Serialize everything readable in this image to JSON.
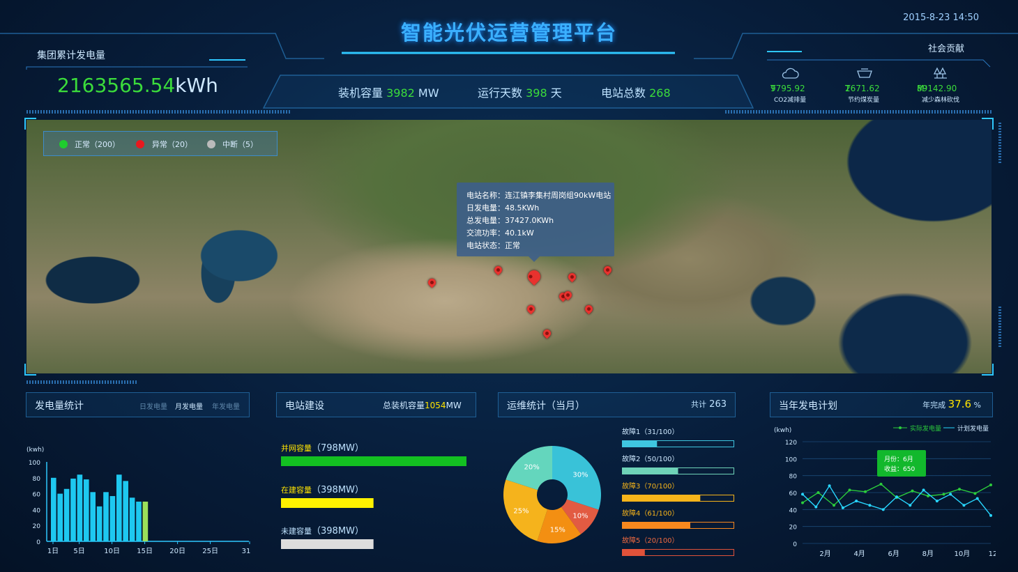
{
  "header": {
    "title": "智能光伏运营管理平台",
    "datetime": "2015-8-23 14:50"
  },
  "cumulative": {
    "label": "集团累计发电量",
    "value": "2163565.54",
    "unit": "kWh"
  },
  "stats": [
    {
      "label": "装机容量",
      "value": "3982",
      "unit": "MW"
    },
    {
      "label": "运行天数",
      "value": "398",
      "unit": "天"
    },
    {
      "label": "电站总数",
      "value": "268",
      "unit": ""
    }
  ],
  "contribution": {
    "label": "社会贡献",
    "items": [
      {
        "icon": "cloud-icon",
        "value": "9795.92",
        "unit": "T",
        "desc": "CO2减排量"
      },
      {
        "icon": "coal-icon",
        "value": "2671.62",
        "unit": "T",
        "desc": "节约煤炭量"
      },
      {
        "icon": "forest-icon",
        "value": "89142.90",
        "unit": "M³",
        "desc": "减少森林砍伐"
      }
    ]
  },
  "legend": [
    {
      "label": "正常（200）",
      "color": "#1fcc2e"
    },
    {
      "label": "异常（20）",
      "color": "#e8191e"
    },
    {
      "label": "中断（5）",
      "color": "#bbbbbb"
    }
  ],
  "tooltip": {
    "lines": [
      "电站名称：连江镇李集村周岗组90kW电站",
      "日发电量：48.5KWh",
      "总发电量：37427.0KWh",
      "交流功率：40.1kW",
      "电站状态：正常"
    ]
  },
  "panel_power": {
    "title": "发电量统计",
    "tabs": [
      "日发电量",
      "月发电量",
      "年发电量"
    ],
    "unit": "(kwh)",
    "y_ticks": [
      "100",
      "80",
      "60",
      "40",
      "20",
      "0"
    ],
    "x_ticks": [
      "1日",
      "5日",
      "10日",
      "15日",
      "20日",
      "25日",
      "31日"
    ]
  },
  "panel_build": {
    "title": "电站建设",
    "total_label": "总装机容量",
    "total_value": "1054",
    "total_unit": "MW",
    "items": [
      {
        "label": "并网容量",
        "value": "798",
        "unit": "MW"
      },
      {
        "label": "在建容量",
        "value": "398",
        "unit": "MW"
      },
      {
        "label": "未建容量",
        "value": "398",
        "unit": "MW"
      }
    ]
  },
  "panel_ops": {
    "title": "运维统计（当月）",
    "total_label": "共计",
    "total_value": "263",
    "faults": [
      {
        "label": "故障1（31/100）"
      },
      {
        "label": "故障2（50/100）"
      },
      {
        "label": "故障3（70/100）"
      },
      {
        "label": "故障4（61/100）"
      },
      {
        "label": "故障5（20/100）"
      }
    ],
    "pie_labels": [
      "30%",
      "10%",
      "15%",
      "25%",
      "20%"
    ]
  },
  "panel_plan": {
    "title": "当年发电计划",
    "complete_label": "年完成",
    "complete_value": "37.6",
    "complete_unit": "%",
    "unit": "(kwh)",
    "legend_actual": "实际发电量",
    "legend_plan": "计划发电量",
    "y_ticks": [
      "120",
      "100",
      "80",
      "60",
      "40",
      "20",
      "0"
    ],
    "x_ticks": [
      "2月",
      "4月",
      "6月",
      "8月",
      "10月",
      "12月"
    ],
    "tooltip": [
      "月份：6月",
      "收益：650"
    ]
  },
  "chart_data": [
    {
      "type": "bar",
      "title": "发电量统计",
      "ylabel": "(kwh)",
      "ylim": [
        0,
        100
      ],
      "x": [
        1,
        2,
        3,
        4,
        5,
        6,
        7,
        8,
        9,
        10,
        11,
        12,
        13,
        14,
        15
      ],
      "values": [
        80,
        60,
        66,
        79,
        84,
        78,
        62,
        44,
        62,
        57,
        84,
        76,
        55,
        50,
        50
      ],
      "colors": [
        "#1ec8f0",
        "#1ec8f0",
        "#1ec8f0",
        "#1ec8f0",
        "#1ec8f0",
        "#1ec8f0",
        "#1ec8f0",
        "#1ec8f0",
        "#1ec8f0",
        "#1ec8f0",
        "#1ec8f0",
        "#1ec8f0",
        "#1ec8f0",
        "#1ec8f0",
        "#9be05a"
      ]
    },
    {
      "type": "bar",
      "title": "电站建设",
      "categories": [
        "并网容量",
        "在建容量",
        "未建容量"
      ],
      "values": [
        798,
        398,
        398
      ],
      "colors": [
        "#13c021",
        "#fff200",
        "#dddddd"
      ]
    },
    {
      "type": "bar",
      "title": "运维统计（当月）",
      "categories": [
        "故障1",
        "故障2",
        "故障3",
        "故障4",
        "故障5"
      ],
      "values": [
        31,
        50,
        70,
        61,
        20
      ],
      "max": 100,
      "colors": [
        "#3fc6e0",
        "#6fd3b8",
        "#f6b41a",
        "#f7881e",
        "#e0523a"
      ]
    },
    {
      "type": "pie",
      "title": "运维统计（当月）",
      "values": [
        30,
        10,
        15,
        25,
        20
      ],
      "labels": [
        "30%",
        "10%",
        "15%",
        "25%",
        "20%"
      ],
      "colors": [
        "#39c2d8",
        "#e25b42",
        "#f38f12",
        "#f5b31c",
        "#64d6bd"
      ]
    },
    {
      "type": "line",
      "title": "当年发电计划",
      "ylabel": "(kwh)",
      "ylim": [
        0,
        120
      ],
      "series": [
        {
          "name": "实际发电量",
          "color": "#2ccc3c",
          "values": [
            48,
            60,
            45,
            63,
            61,
            70,
            54,
            62,
            56,
            58,
            64,
            59,
            69
          ]
        },
        {
          "name": "计划发电量",
          "color": "#28d6ff",
          "values": [
            58,
            43,
            68,
            42,
            50,
            45,
            40,
            55,
            45,
            63,
            50,
            58,
            45,
            53,
            33
          ]
        }
      ]
    }
  ]
}
